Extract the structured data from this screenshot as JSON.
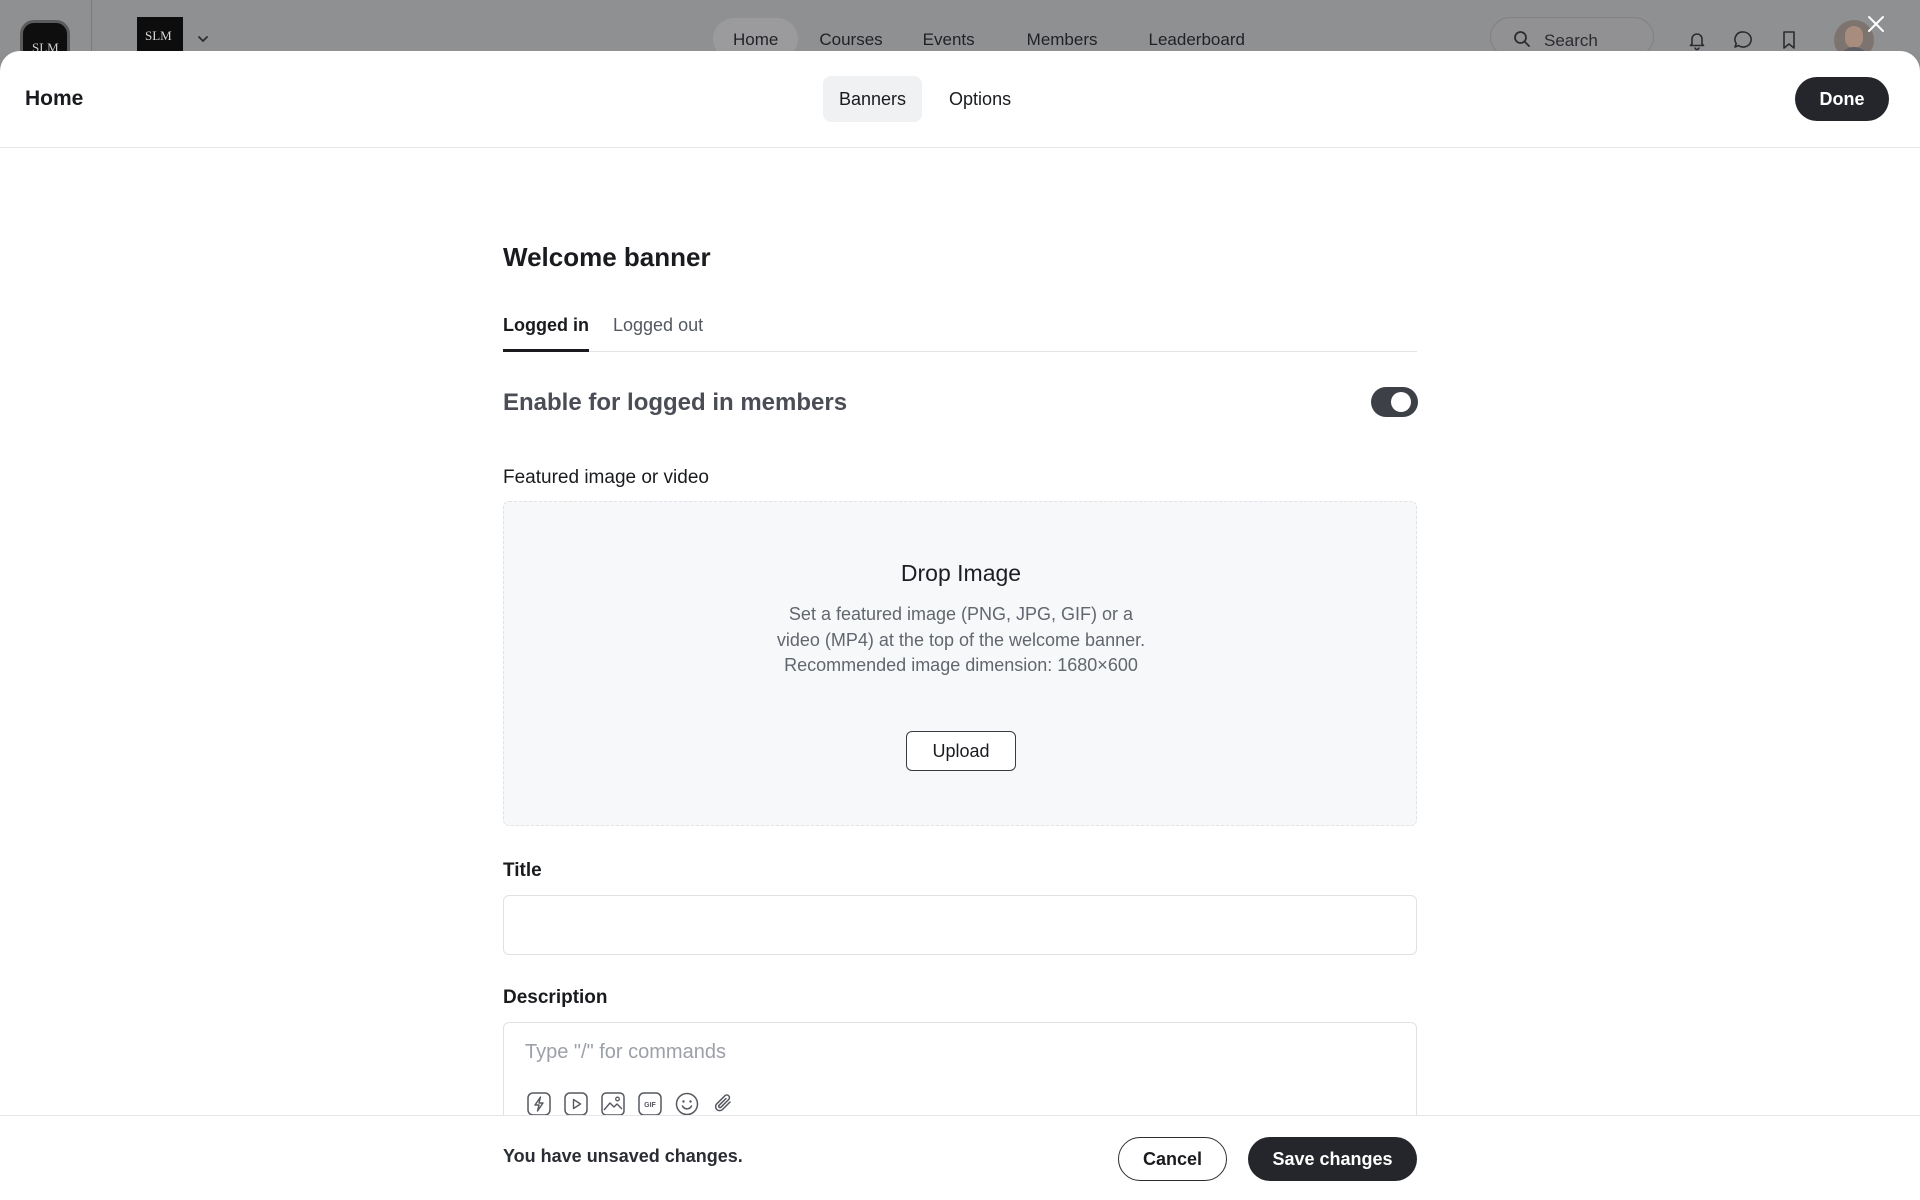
{
  "nav": {
    "brand_round_text": "SLM",
    "brand_square_text": "SLM",
    "links": [
      "Home",
      "Courses",
      "Events",
      "Members",
      "Leaderboard"
    ],
    "search_label": "Search",
    "icons": [
      "bell-icon",
      "chat-icon",
      "bookmark-icon"
    ]
  },
  "modal": {
    "title": "Home",
    "header_tabs": [
      "Banners",
      "Options"
    ],
    "done_label": "Done"
  },
  "welcome": {
    "section_title": "Welcome banner",
    "tabs": [
      "Logged in",
      "Logged out"
    ],
    "enable_label": "Enable for logged in members",
    "enabled": true,
    "featured_label": "Featured image or video",
    "drop_title": "Drop Image",
    "drop_text": "Set a featured image (PNG, JPG, GIF) or a video (MP4) at the top of the welcome banner. Recommended image dimension: 1680×600",
    "upload_label": "Upload",
    "title_label": "Title",
    "title_value": "",
    "description_label": "Description",
    "description_placeholder": "Type \"/\" for commands",
    "toolbar_icons": [
      "lightning-icon",
      "video-icon",
      "image-icon",
      "gif-icon",
      "emoji-icon",
      "attachment-icon"
    ]
  },
  "footer": {
    "message": "You have unsaved changes.",
    "cancel_label": "Cancel",
    "save_label": "Save changes"
  },
  "colors": {
    "primary_dark": "#25262b",
    "overlay_gray": "#8f9092"
  }
}
